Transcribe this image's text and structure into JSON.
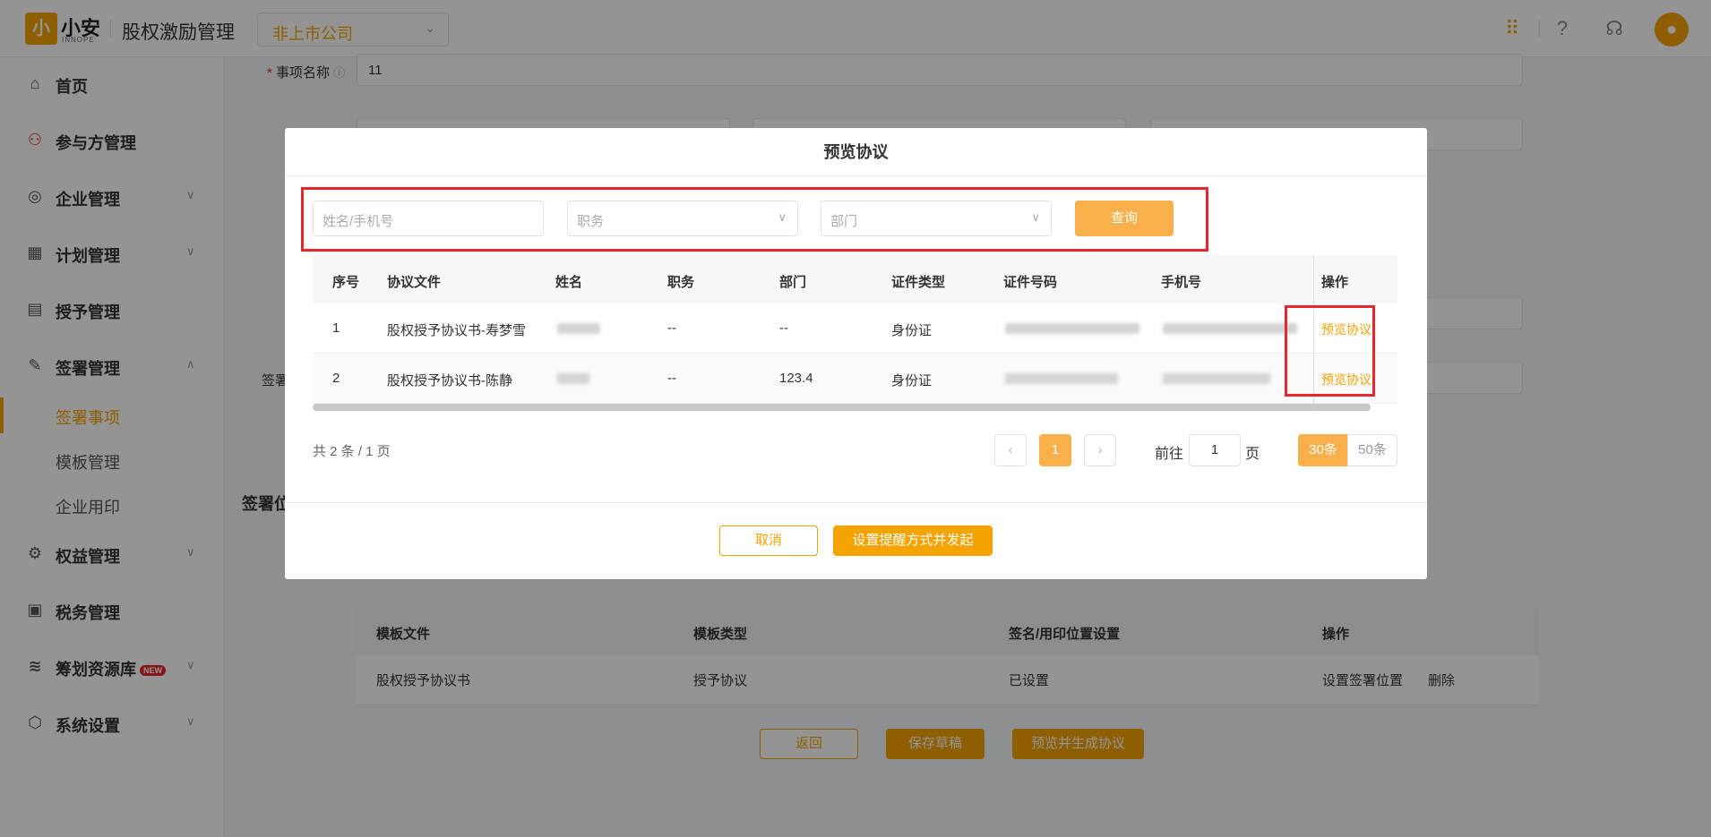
{
  "header": {
    "logo_glyph": "小",
    "logo_text": "小安",
    "logo_sub": "INNOPE",
    "app_title": "股权激励管理",
    "company_select": "非上市公司",
    "icons": [
      "apps-grid-icon",
      "help-icon",
      "customer-service-icon",
      "user-avatar-icon"
    ]
  },
  "sidebar": {
    "items": [
      {
        "label": "首页",
        "icon": "home-icon"
      },
      {
        "label": "参与方管理",
        "icon": "users-icon"
      },
      {
        "label": "企业管理",
        "icon": "enterprise-icon"
      },
      {
        "label": "计划管理",
        "icon": "plan-icon"
      },
      {
        "label": "授予管理",
        "icon": "grant-icon"
      },
      {
        "label": "签署管理",
        "icon": "sign-icon"
      },
      {
        "label": "权益管理",
        "icon": "equity-icon"
      },
      {
        "label": "税务管理",
        "icon": "tax-icon"
      },
      {
        "label": "筹划资源库",
        "icon": "layers-icon",
        "badge": "NEW"
      },
      {
        "label": "系统设置",
        "icon": "settings-icon"
      }
    ],
    "sub_items": [
      "签署事项",
      "模板管理",
      "企业用印"
    ]
  },
  "main": {
    "field_label": "事项名称",
    "field_value": "11",
    "partial_label": "签署",
    "section_label": "签署位",
    "tpl_headers": [
      "模板文件",
      "模板类型",
      "签名/用印位置设置",
      "操作"
    ],
    "tpl_row": {
      "file": "股权授予协议书",
      "type": "授予协议",
      "status": "已设置",
      "op1": "设置签署位置",
      "op2": "删除"
    },
    "buttons": {
      "back": "返回",
      "save": "保存草稿",
      "preview": "预览并生成协议"
    }
  },
  "modal": {
    "title": "预览协议",
    "filter": {
      "name_placeholder": "姓名/手机号",
      "position_placeholder": "职务",
      "dept_placeholder": "部门",
      "query": "查询"
    },
    "columns": [
      "序号",
      "协议文件",
      "姓名",
      "职务",
      "部门",
      "证件类型",
      "证件号码",
      "手机号",
      "操作"
    ],
    "rows": [
      {
        "no": "1",
        "file": "股权授予协议书-寿梦雪",
        "position": "--",
        "dept": "--",
        "id_type": "身份证",
        "op": "预览协议"
      },
      {
        "no": "2",
        "file": "股权授予协议书-陈静",
        "position": "--",
        "dept": "123.4",
        "id_type": "身份证",
        "op": "预览协议"
      }
    ],
    "pagination": {
      "total": "共 2 条 / 1 页",
      "current": "1",
      "goto_prefix": "前往",
      "goto_value": "1",
      "goto_suffix": "页",
      "size_30": "30条",
      "size_50": "50条"
    },
    "footer": {
      "cancel": "取消",
      "confirm": "设置提醒方式并发起"
    }
  }
}
